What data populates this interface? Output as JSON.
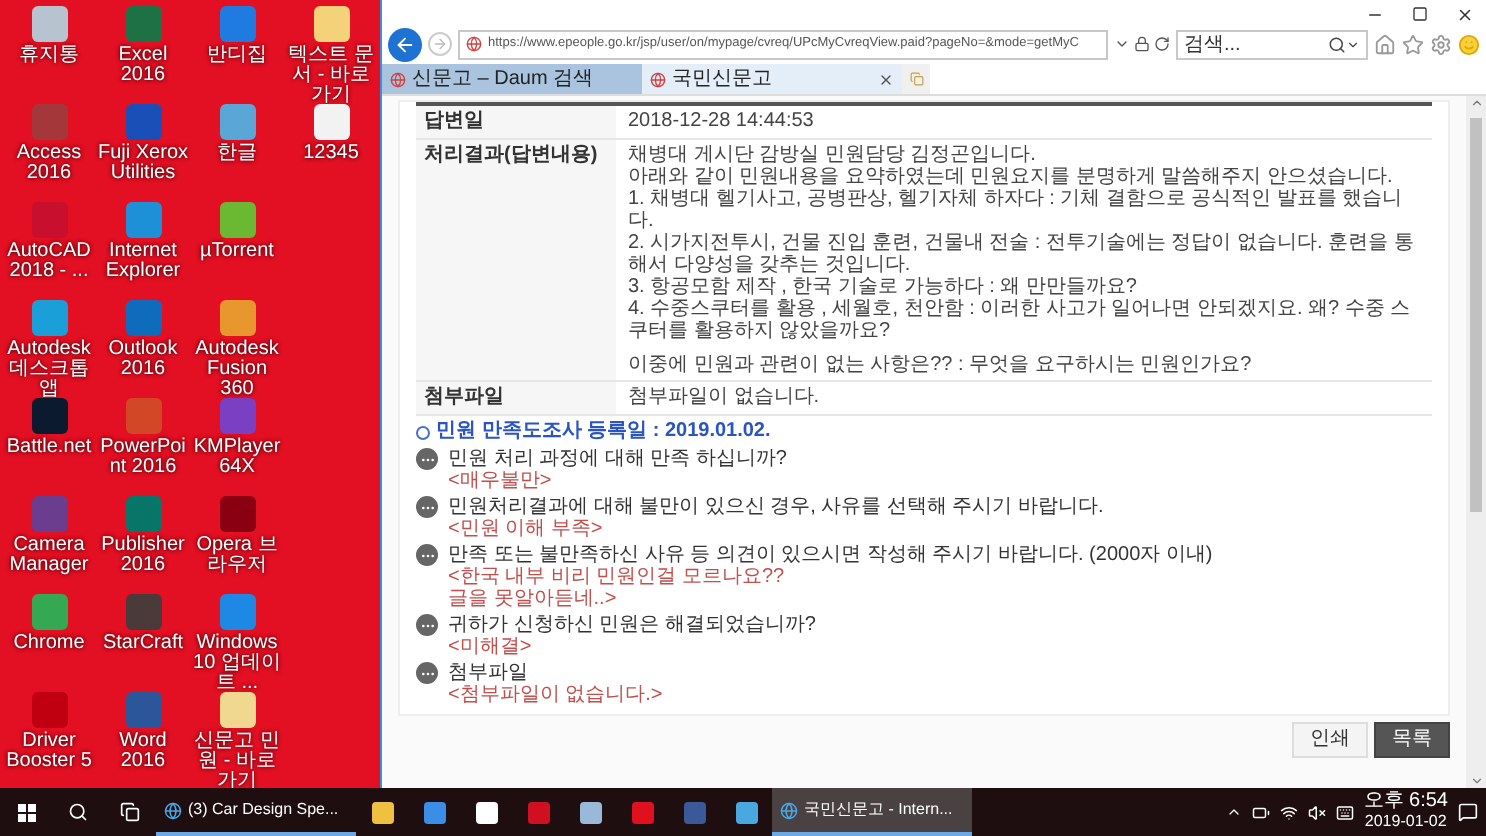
{
  "desktop": {
    "columns": [
      [
        {
          "label": "휴지통",
          "color": "#b7c3cf"
        },
        {
          "label": "Access 2016",
          "color": "#a4373a"
        },
        {
          "label": "AutoCAD 2018 - ...",
          "color": "#c8102e"
        },
        {
          "label": "Autodesk 데스크톱 앱",
          "color": "#1a9fd9"
        },
        {
          "label": "Battle.net",
          "color": "#0b1a2e"
        },
        {
          "label": "Camera Manager",
          "color": "#6a3d8f"
        },
        {
          "label": "Chrome",
          "color": "#34a853"
        },
        {
          "label": "Driver Booster 5",
          "color": "#c00010"
        }
      ],
      [
        {
          "label": "Excel 2016",
          "color": "#1e7145"
        },
        {
          "label": "Fuji Xerox Utilities",
          "color": "#1b4fb8"
        },
        {
          "label": "Internet Explorer",
          "color": "#1e90d8"
        },
        {
          "label": "Outlook 2016",
          "color": "#0f6cbd"
        },
        {
          "label": "PowerPoint 2016",
          "color": "#d24726"
        },
        {
          "label": "Publisher 2016",
          "color": "#077568"
        },
        {
          "label": "StarCraft",
          "color": "#4a3a3a"
        },
        {
          "label": "Word 2016",
          "color": "#2b579a"
        }
      ],
      [
        {
          "label": "반디집",
          "color": "#1f7be0"
        },
        {
          "label": "한글",
          "color": "#5aa6d6"
        },
        {
          "label": "µTorrent",
          "color": "#6bb833"
        },
        {
          "label": "Autodesk Fusion 360",
          "color": "#e8962e"
        },
        {
          "label": "KMPlayer 64X",
          "color": "#7b3fc4"
        },
        {
          "label": "Opera 브라우저",
          "color": "#8a0012"
        },
        {
          "label": "Windows 10 업데이트 ...",
          "color": "#1e88e5"
        },
        {
          "label": "신문고 민원 - 바로 가기",
          "color": "#f0d890"
        }
      ],
      [
        {
          "label": "텍스트 문서 - 바로 가기",
          "color": "#f3d27a"
        },
        {
          "label": "12345",
          "color": "#f2f2f2"
        }
      ]
    ]
  },
  "browser": {
    "url": "https://www.epeople.go.kr/jsp/user/on/mypage/cvreq/UPcMyCvreqView.paid?pageNo=&mode=getMyC",
    "search": {
      "placeholder": "검색..."
    },
    "tabs": [
      {
        "label": "신문고 – Daum 검색",
        "selected": false
      },
      {
        "label": "국민신문고",
        "selected": true
      }
    ]
  },
  "detail": {
    "rows": [
      {
        "label": "답변일",
        "lines": [
          "2018-12-28 14:44:53"
        ]
      },
      {
        "label": "처리결과(답변내용)",
        "lines": [
          "채병대 게시단 감방실 민원담당 김정곤입니다.",
          "아래와 같이 민원내용을 요약하였는데 민원요지를 분명하게 말씀해주지 안으셨습니다.",
          "1. 채병대 헬기사고, 공병판상, 헬기자체 하자다 : 기체 결함으로 공식적인 발표를 했습니다.",
          "2. 시가지전투시, 건물 진입 훈련, 건물내 전술 : 전투기술에는 정답이 없습니다. 훈련을 통해서 다양성을 갖추는 것입니다.",
          "3. 항공모함 제작 , 한국 기술로 가능하다 : 왜 만만들까요?",
          "4. 수중스쿠터를 활용 , 세월호, 천안함 : 이러한 사고가 일어나면 안되겠지요. 왜? 수중 스쿠터를 활용하지 않았을까요?",
          "이중에 민원과 관련이 없는 사항은?? : 무엇을 요구하시는 민원인가요?"
        ]
      },
      {
        "label": "첨부파일",
        "lines": [
          "첨부파일이 없습니다."
        ]
      }
    ]
  },
  "survey_date": "민원 만족도조사 등록일 : 2019.01.02.",
  "survey": [
    {
      "question": "민원 처리 과정에 대해 만족 하십니까?",
      "answer": [
        "<매우불만>"
      ]
    },
    {
      "question": "민원처리결과에 대해 불만이 있으신 경우, 사유를 선택해 주시기 바랍니다.",
      "answer": [
        "<민원 이해 부족>"
      ]
    },
    {
      "question": "만족 또는 불만족하신 사유 등 의견이 있으시면 작성해 주시기 바랍니다. (2000자 이내)",
      "answer": [
        "<한국 내부 비리 민원인걸 모르나요??",
        "글을 못알아듣네..>"
      ]
    },
    {
      "question": "귀하가 신청하신 민원은 해결되었습니까?",
      "answer": [
        "<미해결>"
      ]
    },
    {
      "question": "첨부파일",
      "answer": [
        "<첨부파일이 없습니다.>"
      ]
    }
  ],
  "buttons": [
    {
      "label": "인쇄",
      "kind": "secondary"
    },
    {
      "label": "목록",
      "kind": "primary"
    }
  ],
  "taskbar": {
    "items": [
      {
        "kind": "window",
        "label": "(3) Car Design Spe...",
        "selected": false
      },
      {
        "kind": "pinned",
        "color": "#f0c040"
      },
      {
        "kind": "pinned",
        "color": "#3a8ee6"
      },
      {
        "kind": "pinned",
        "color": "#ffffff"
      },
      {
        "kind": "pinned",
        "color": "#d01020"
      },
      {
        "kind": "pinned",
        "color": "#9ab8d8"
      },
      {
        "kind": "pinned",
        "color": "#e0101e"
      },
      {
        "kind": "pinned",
        "color": "#3b5998"
      },
      {
        "kind": "pinned",
        "color": "#4aa8e0"
      },
      {
        "kind": "window",
        "label": "국민신문고 - Intern...",
        "selected": true
      }
    ],
    "time": "오후 6:54",
    "date": "2019-01-02"
  }
}
